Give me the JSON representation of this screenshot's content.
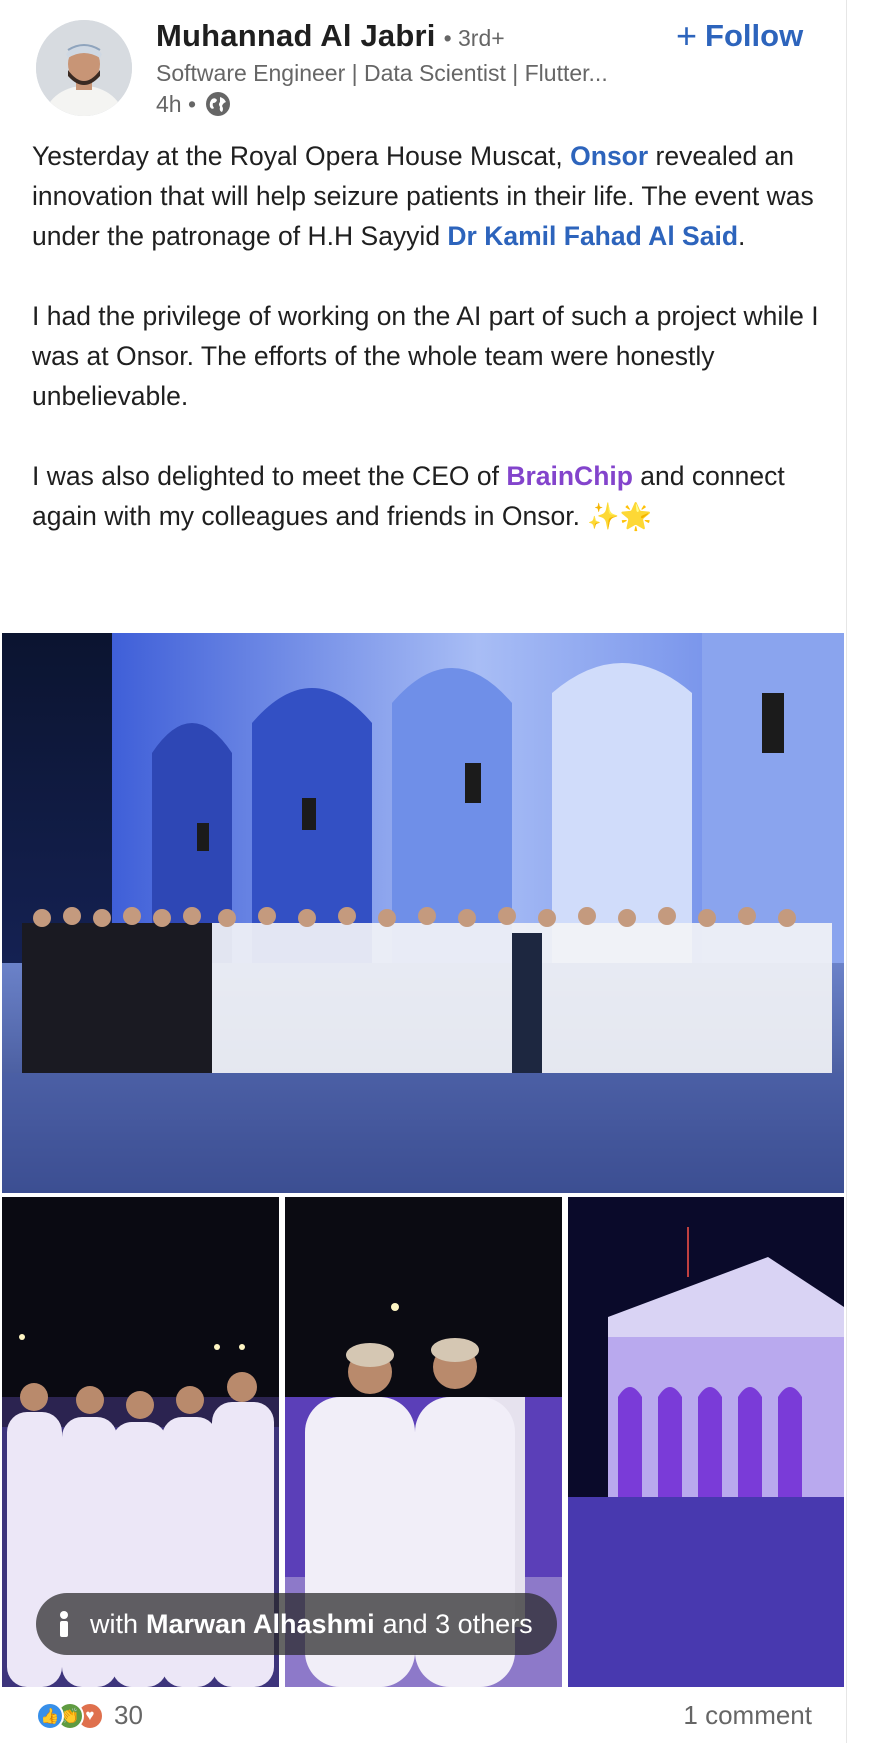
{
  "author": {
    "name": "Muhannad Al Jabri",
    "degree": "• 3rd+",
    "headline": "Software Engineer | Data Scientist | Flutter...",
    "time": "4h •"
  },
  "follow_label": "Follow",
  "post": {
    "p1_a": "Yesterday at the Royal Opera House Muscat, ",
    "p1_mention1": "Onsor",
    "p1_b": " revealed an innovation that will help seizure patients in their life. The event was under the patronage of H.H Sayyid ",
    "p1_mention2": "Dr Kamil Fahad Al Said",
    "p1_c": ".",
    "p2": "I had the privilege of working on the AI part of such a project while I was at Onsor. The efforts of the whole team were honestly unbelievable.",
    "p3_a": "I was also delighted to meet the CEO of ",
    "p3_mention": "BrainChip",
    "p3_b": " and connect again with my colleagues and friends in Onsor. ",
    "p3_emoji": "✨🌟"
  },
  "tag": {
    "prefix": "with",
    "name": "Marwan Alhashmi",
    "suffix": "and 3 others"
  },
  "social": {
    "reaction_count": "30",
    "comments": "1 comment"
  },
  "colors": {
    "link": "#2d64bc",
    "company": "#8344cc",
    "muted": "#666666"
  }
}
